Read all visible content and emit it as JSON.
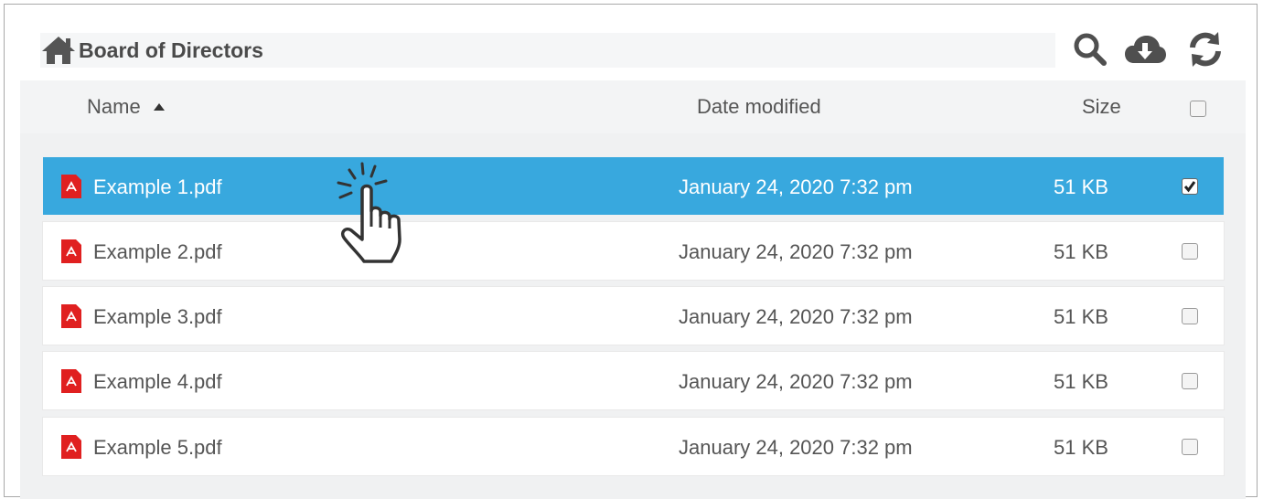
{
  "window": {
    "title": "Board of Directors"
  },
  "breadcrumb": {
    "home_icon": "home-icon",
    "title": "Board of Directors"
  },
  "toolbar": {
    "buttons": [
      {
        "icon": "search-icon"
      },
      {
        "icon": "cloud-download-icon"
      },
      {
        "icon": "refresh-icon"
      }
    ]
  },
  "table": {
    "columns": {
      "name": "Name",
      "date": "Date modified",
      "size": "Size"
    },
    "sort": {
      "column": "Name",
      "direction": "ascending"
    },
    "rows": [
      {
        "name": "Example 1.pdf",
        "date": "January 24, 2020 7:32 pm",
        "size": "51 KB",
        "checked": true,
        "selected": true
      },
      {
        "name": "Example 2.pdf",
        "date": "January 24, 2020 7:32 pm",
        "size": "51 KB",
        "checked": false,
        "selected": false
      },
      {
        "name": "Example 3.pdf",
        "date": "January 24, 2020 7:32 pm",
        "size": "51 KB",
        "checked": false,
        "selected": false
      },
      {
        "name": "Example 4.pdf",
        "date": "January 24, 2020 7:32 pm",
        "size": "51 KB",
        "checked": false,
        "selected": false
      },
      {
        "name": "Example 5.pdf",
        "date": "January 24, 2020 7:32 pm",
        "size": "51 KB",
        "checked": false,
        "selected": false
      }
    ]
  },
  "colors": {
    "selected_row": "#38a8de",
    "pdf_icon": "#e02020",
    "icon_gray": "#4f4f4f"
  }
}
